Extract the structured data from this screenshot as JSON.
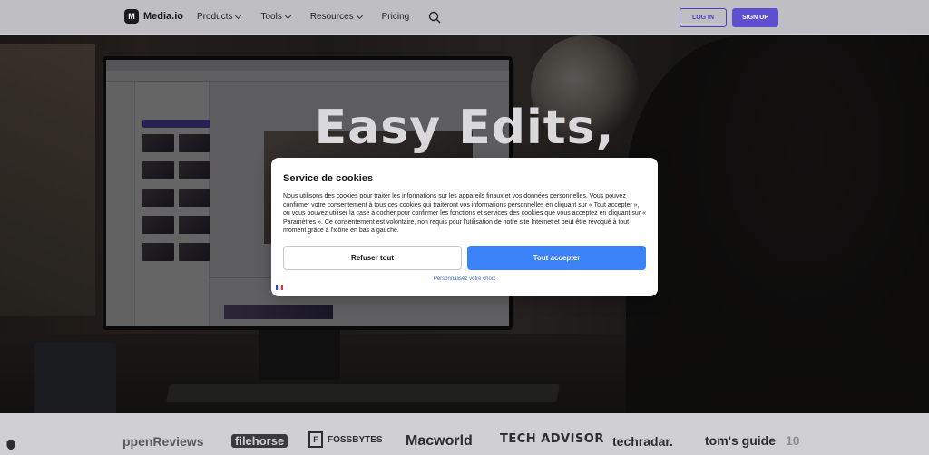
{
  "header": {
    "logo_text": "Media.io",
    "nav": [
      {
        "label": "Products",
        "has_dropdown": true
      },
      {
        "label": "Tools",
        "has_dropdown": true
      },
      {
        "label": "Resources",
        "has_dropdown": true
      },
      {
        "label": "Pricing",
        "has_dropdown": false
      }
    ],
    "login_label": "LOG IN",
    "signup_label": "SIGN UP",
    "accent_color": "#5d4fd0"
  },
  "hero": {
    "title": "Easy Edits,"
  },
  "cookie_dialog": {
    "title": "Service de cookies",
    "body": "Nous utilisons des cookies pour traiter les informations sur les appareils finaux et vos données personnelles. Vous pouvez confirmer votre consentement à tous ces cookies qui traiteront vos informations personnelles en cliquant sur « Tout accepter », ou vous pouvez utiliser la case à cocher pour confirmer les fonctions et services des cookies que vous acceptez en cliquant sur « Paramètres ». Ce consentement est volontaire, non requis pour l'utilisation de notre site Internet et peut être révoqué à tout moment grâce à l'icône en bas à gauche.",
    "refuse_label": "Refuser tout",
    "accept_label": "Tout accepter",
    "customize_label": "Personnalisez votre choix",
    "accept_color": "#3b82f6"
  },
  "press": [
    {
      "name": "ppenReviews",
      "icon": "none"
    },
    {
      "name": "filehorse",
      "icon": "none"
    },
    {
      "name": "FOSSBYTES",
      "icon": "fossbytes-logo"
    },
    {
      "name": "Macworld",
      "icon": "none"
    },
    {
      "name": "TECH ADVISOR",
      "icon": "none"
    },
    {
      "name": "techradar.",
      "icon": "none"
    },
    {
      "name": "tom's guide",
      "icon": "none"
    },
    {
      "name": "10",
      "icon": "none"
    }
  ]
}
